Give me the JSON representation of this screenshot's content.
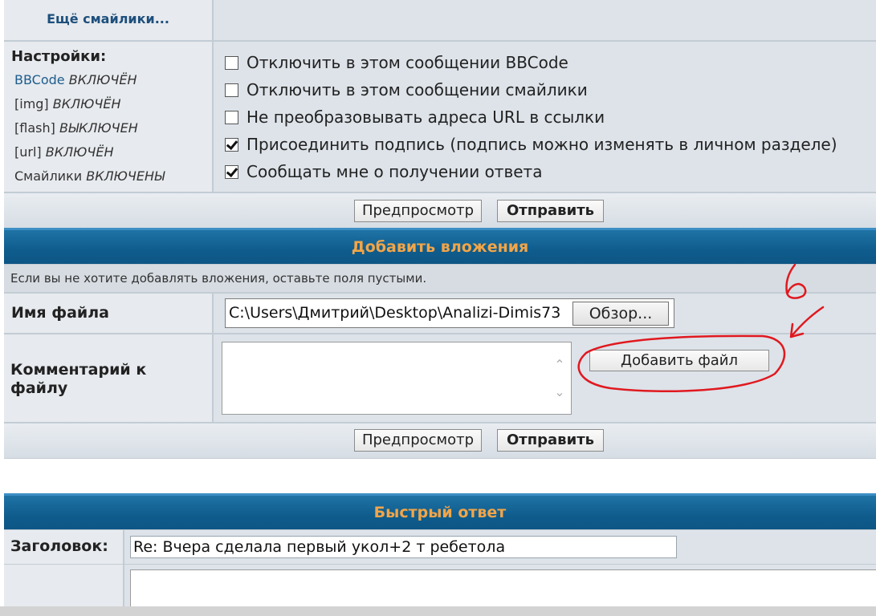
{
  "smilies": {
    "more_link": "Ещё смайлики..."
  },
  "settings": {
    "title": "Настройки:",
    "items": [
      {
        "name": "BBCode",
        "state": "ВКЛЮЧЁН"
      },
      {
        "name": "[img]",
        "state": "ВКЛЮЧЁН"
      },
      {
        "name": "[flash]",
        "state": "ВЫКЛЮЧЕН"
      },
      {
        "name": "[url]",
        "state": "ВКЛЮЧЁН"
      },
      {
        "name": "Смайлики",
        "state": "ВКЛЮЧЕНЫ"
      }
    ]
  },
  "options": [
    {
      "label": "Отключить в этом сообщении BBCode",
      "checked": false
    },
    {
      "label": "Отключить в этом сообщении смайлики",
      "checked": false
    },
    {
      "label": "Не преобразовывать адреса URL в ссылки",
      "checked": false
    },
    {
      "label": "Присоединить подпись (подпись можно изменять в личном разделе)",
      "checked": true
    },
    {
      "label": "Сообщать мне о получении ответа",
      "checked": true
    }
  ],
  "buttons": {
    "preview": "Предпросмотр",
    "submit": "Отправить"
  },
  "attachments": {
    "header": "Добавить вложения",
    "note": "Если вы не хотите добавлять вложения, оставьте поля пустыми.",
    "filename_label": "Имя файла",
    "file_value": "C:\\Users\\Дмитрий\\Desktop\\Analizi-Dimis73",
    "browse_label": "Обзор...",
    "comment_label": "Комментарий к файлу",
    "add_file_label": "Добавить файл"
  },
  "annotation": {
    "text": "6",
    "color": "#e0191f"
  },
  "quick_reply": {
    "header": "Быстрый ответ",
    "subject_label": "Заголовок:",
    "subject_value": "Re: Вчера сделала первый укол+2 т ребетола"
  }
}
